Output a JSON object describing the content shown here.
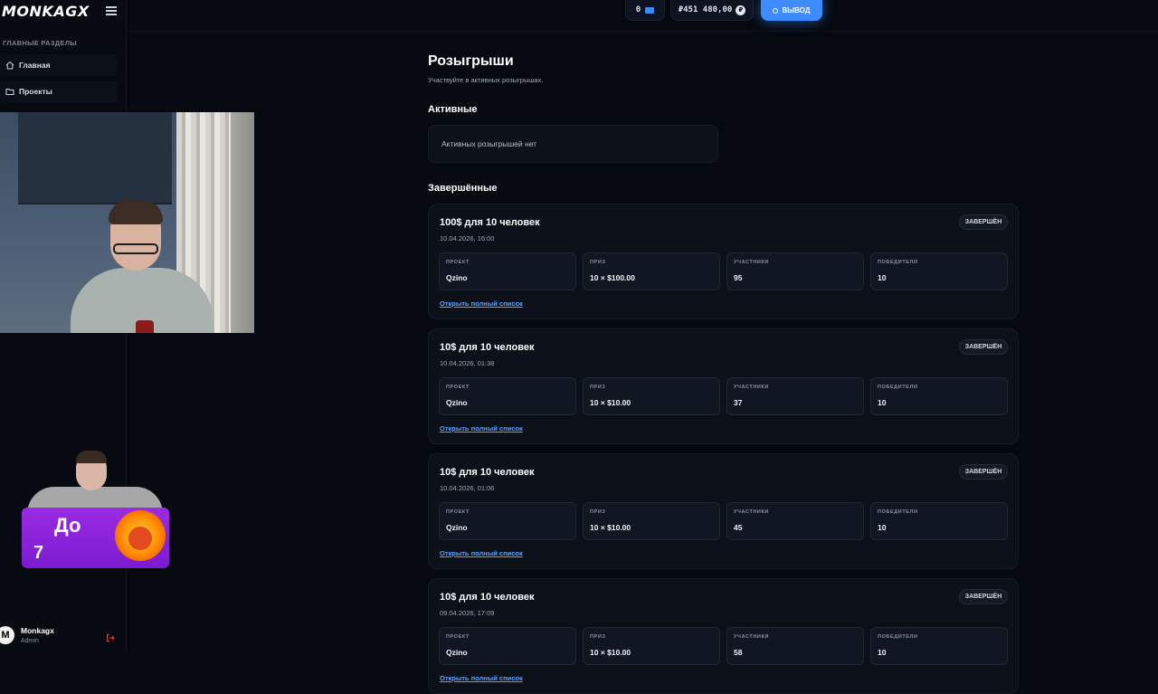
{
  "sidebar": {
    "logo": "MONKAGX",
    "section_label": "ГЛАВНЫЕ РАЗДЕЛЫ",
    "items": [
      {
        "label": "Главная",
        "icon": "home-icon"
      },
      {
        "label": "Проекты",
        "icon": "folder-icon"
      }
    ],
    "user": {
      "avatar_letter": "M",
      "name": "Monkagx",
      "role": "Admin"
    }
  },
  "overlay": {
    "promo_line1": "До",
    "promo_line2": "7"
  },
  "header": {
    "ticket_count": "0",
    "balance": "₽451 480,00",
    "currency_symbol": "₽",
    "withdraw_label": "ВЫВОД",
    "accent_color": "#3d8bff"
  },
  "page": {
    "title": "Розыгрыши",
    "subtitle": "Участвуйте в активных розыгрышах.",
    "active_heading": "Активные",
    "active_empty": "Активных розыгрышей нет",
    "finished_heading": "Завершённые"
  },
  "stat_labels": {
    "project": "ПРОЕКТ",
    "prize": "ПРИЗ",
    "participants": "УЧАСТНИКИ",
    "winners": "ПОБЕДИТЕЛИ"
  },
  "raffles": [
    {
      "title": "100$ для 10 человек",
      "date": "10.04.2026, 16:00",
      "status": "ЗАВЕРШЁН",
      "project": "Qzino",
      "prize": "10 × $100.00",
      "participants": "95",
      "winners": "10",
      "link": "Открыть полный список"
    },
    {
      "title": "10$ для 10 человек",
      "date": "10.04.2026, 01:38",
      "status": "ЗАВЕРШЁН",
      "project": "Qzino",
      "prize": "10 × $10.00",
      "participants": "37",
      "winners": "10",
      "link": "Открыть полный список"
    },
    {
      "title": "10$ для 10 человек",
      "date": "10.04.2026, 01:06",
      "status": "ЗАВЕРШЁН",
      "project": "Qzino",
      "prize": "10 × $10.00",
      "participants": "45",
      "winners": "10",
      "link": "Открыть полный список"
    },
    {
      "title": "10$ для 10 человек",
      "date": "09.04.2026, 17:09",
      "status": "ЗАВЕРШЁН",
      "project": "Qzino",
      "prize": "10 × $10.00",
      "participants": "58",
      "winners": "10",
      "link": "Открыть полный список"
    }
  ]
}
